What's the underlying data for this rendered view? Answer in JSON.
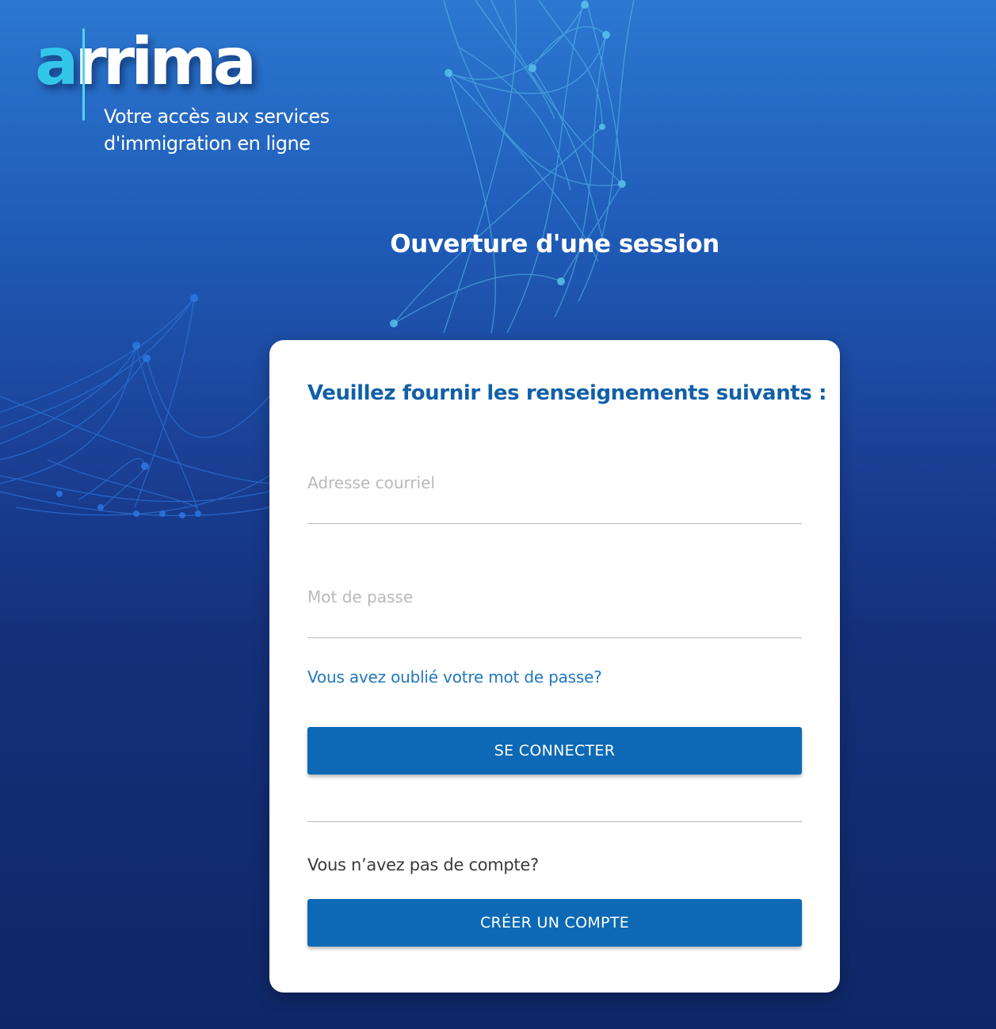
{
  "branding": {
    "logo_first_letter": "a",
    "logo_rest": "rrima",
    "tagline_line1": "Votre accès aux services",
    "tagline_line2": "d'immigration en ligne"
  },
  "page": {
    "title": "Ouverture d'une session"
  },
  "login_form": {
    "heading": "Veuillez fournir les renseignements suivants :",
    "email_placeholder": "Adresse courriel",
    "email_value": "",
    "password_placeholder": "Mot de passe",
    "password_value": "",
    "forgot_password_link": "Vous avez oublié votre mot de passe?",
    "login_button": "SE CONNECTER"
  },
  "signup": {
    "prompt": "Vous n’avez pas de compte?",
    "create_account_button": "CRÉER UN COMPTE"
  },
  "colors": {
    "background_top": "#2c78d0",
    "background_bottom": "#0f2766",
    "logo_accent": "#34c6ea",
    "heading_blue": "#1160a8",
    "link_blue": "#2177c0",
    "button_blue": "#0d69b5"
  }
}
